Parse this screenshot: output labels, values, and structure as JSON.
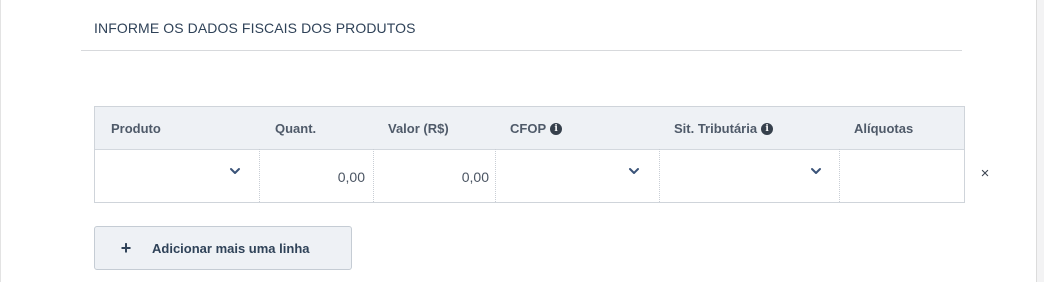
{
  "section": {
    "title": "INFORME OS DADOS FISCAIS DOS PRODUTOS"
  },
  "table": {
    "columns": [
      "Produto",
      "Quant.",
      "Valor (R$)",
      "CFOP",
      "Sit. Tributária",
      "Alíquotas"
    ],
    "info_icon_columns": [
      "CFOP",
      "Sit. Tributária"
    ],
    "rows": [
      {
        "produto": "",
        "quantidade": "0,00",
        "valor": "0,00",
        "cfop": "",
        "situacao_tributaria": "",
        "aliquotas": ""
      }
    ],
    "remove_glyph": "×"
  },
  "actions": {
    "add_row_icon": "plus-icon",
    "add_row_label": "Adicionar mais uma linha"
  },
  "colors": {
    "heading": "#2f4258",
    "header_bg": "#eef1f5",
    "border": "#cfd4da",
    "chevron": "#3a5378"
  }
}
